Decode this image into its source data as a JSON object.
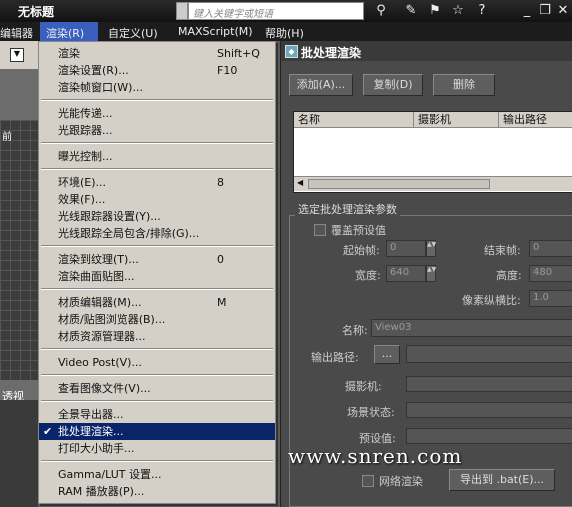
{
  "app": {
    "title": "无标题"
  },
  "search": {
    "placeholder": "键入关键字或短语"
  },
  "toolbar_icons": [
    "binoculars-icon",
    "wrench-icon",
    "pin-icon",
    "star-icon",
    "help-icon"
  ],
  "window_controls": [
    "minimize",
    "restore",
    "close"
  ],
  "menubar": {
    "items": [
      {
        "label": "编辑器"
      },
      {
        "label": "渲染(R)"
      },
      {
        "label": "自定义(U)"
      },
      {
        "label": "MAXScript(M)"
      },
      {
        "label": "帮助(H)"
      }
    ]
  },
  "viewport": {
    "top_label": "前",
    "label": "透视"
  },
  "render_menu": {
    "groups": [
      [
        {
          "label": "渲染",
          "shortcut": "Shift+Q"
        },
        {
          "label": "渲染设置(R)...",
          "shortcut": "F10"
        },
        {
          "label": "渲染帧窗口(W)...",
          "shortcut": ""
        }
      ],
      [
        {
          "label": "光能传递...",
          "shortcut": ""
        },
        {
          "label": "光跟踪器...",
          "shortcut": ""
        }
      ],
      [
        {
          "label": "曝光控制...",
          "shortcut": ""
        }
      ],
      [
        {
          "label": "环境(E)...",
          "shortcut": "8"
        },
        {
          "label": "效果(F)...",
          "shortcut": ""
        },
        {
          "label": "光线跟踪器设置(Y)...",
          "shortcut": ""
        },
        {
          "label": "光线跟踪全局包含/排除(G)...",
          "shortcut": ""
        }
      ],
      [
        {
          "label": "渲染到纹理(T)...",
          "shortcut": "0"
        },
        {
          "label": "渲染曲面贴图...",
          "shortcut": ""
        }
      ],
      [
        {
          "label": "材质编辑器(M)...",
          "shortcut": "M"
        },
        {
          "label": "材质/贴图浏览器(B)...",
          "shortcut": ""
        },
        {
          "label": "材质资源管理器...",
          "shortcut": ""
        }
      ],
      [
        {
          "label": "Video Post(V)...",
          "shortcut": ""
        }
      ],
      [
        {
          "label": "查看图像文件(V)...",
          "shortcut": ""
        }
      ],
      [
        {
          "label": "全景导出器...",
          "shortcut": ""
        },
        {
          "label": "批处理渲染...",
          "shortcut": "",
          "checked": true,
          "selected": true
        },
        {
          "label": "打印大小助手...",
          "shortcut": ""
        }
      ],
      [
        {
          "label": "Gamma/LUT 设置...",
          "shortcut": ""
        },
        {
          "label": "RAM 播放器(P)...",
          "shortcut": ""
        }
      ]
    ]
  },
  "dialog": {
    "title": "批处理渲染",
    "buttons": {
      "add": "添加(A)...",
      "copy": "复制(D)",
      "delete": "删除"
    },
    "columns": [
      "名称",
      "摄影机",
      "输出路径"
    ],
    "group_title": "选定批处理渲染参数",
    "override_label": "覆盖预设值",
    "start_frame_label": "起始帧:",
    "start_frame_value": "0",
    "end_frame_label": "结束帧:",
    "end_frame_value": "0",
    "width_label": "宽度:",
    "width_value": "640",
    "height_label": "高度:",
    "height_value": "480",
    "pixel_aspect_label": "像素纵横比:",
    "pixel_aspect_value": "1.0",
    "name_label": "名称:",
    "name_value": "View03",
    "output_path_label": "输出路径:",
    "output_path_button": "...",
    "camera_label": "摄影机:",
    "scene_state_label": "场景状态:",
    "preset_label": "预设值:",
    "net_render_label": "网络渲染",
    "export_button": "导出到 .bat(E)..."
  },
  "watermark": "www.snren.com"
}
